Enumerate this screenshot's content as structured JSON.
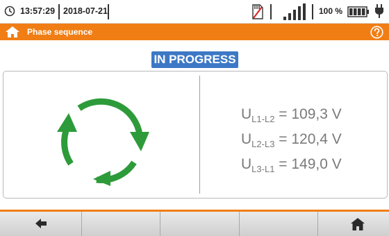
{
  "status_bar": {
    "time": "13:57:29",
    "date": "2018-07-21",
    "battery_percent": "100 %",
    "icons": [
      "clock-icon",
      "memory-card-icon",
      "signal-strength-icon",
      "battery-icon",
      "power-plug-icon"
    ]
  },
  "header": {
    "title": "Phase sequence",
    "accent_color": "#f07e15"
  },
  "main": {
    "status_badge": "IN PROGRESS",
    "badge_color": "#3d78c6",
    "rotation_icon_color": "#2e9b3a",
    "readings": [
      {
        "symbol": "U",
        "subscript": "L1-L2",
        "value": "= 109,3 V"
      },
      {
        "symbol": "U",
        "subscript": "L2-L3",
        "value": "= 120,4 V"
      },
      {
        "symbol": "U",
        "subscript": "L3-L1",
        "value": "= 149,0 V"
      }
    ]
  },
  "toolbar": {
    "buttons": [
      "back-arrow-icon",
      "",
      "",
      "",
      "home-icon"
    ]
  }
}
